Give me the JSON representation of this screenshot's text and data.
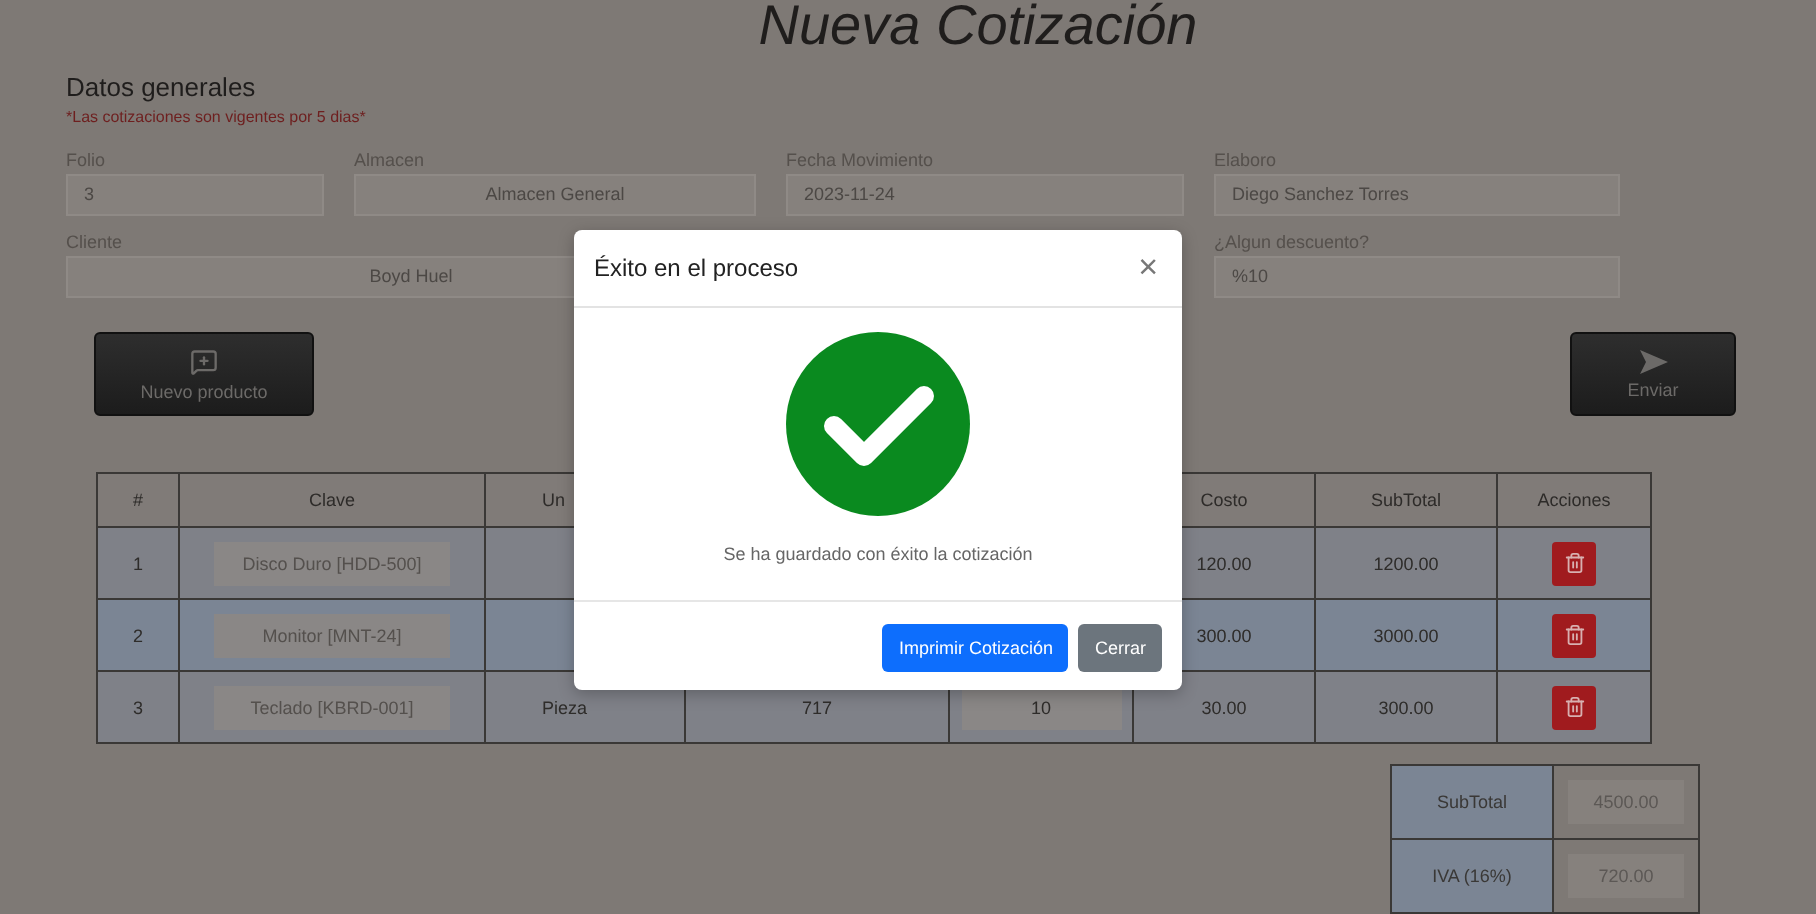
{
  "title": "Nueva Cotización",
  "section": {
    "heading": "Datos generales",
    "note": "*Las cotizaciones son vigentes por 5 dias*"
  },
  "fields": [
    {
      "label": "Folio",
      "value": "3",
      "kind": "text"
    },
    {
      "label": "Almacen",
      "value": "Almacen General",
      "kind": "select"
    },
    {
      "label": "Fecha Movimiento",
      "value": "2023-11-24",
      "kind": "text"
    },
    {
      "label": "Elaboro",
      "value": "Diego Sanchez Torres",
      "kind": "text"
    },
    {
      "label": "Cliente",
      "value": "Boyd Huel",
      "kind": "select",
      "wide": true
    },
    {
      "label": "¿Algun descuento?",
      "value": "%10",
      "kind": "text"
    }
  ],
  "actions": [
    {
      "label": "Nuevo producto",
      "kind": "add"
    },
    {
      "label": "Enviar",
      "kind": "send"
    }
  ],
  "table": {
    "columns": [
      "#",
      "Clave",
      "Un",
      null,
      null,
      "Costo",
      "SubTotal",
      "Acciones"
    ],
    "rows": [
      {
        "number": "1",
        "clave": "Disco Duro [HDD-500]",
        "costo": "120.00",
        "subtotal": "1200.00"
      },
      {
        "number": "2",
        "clave": "Monitor [MNT-24]",
        "costo": "300.00",
        "subtotal": "3000.00"
      },
      {
        "number": "3",
        "clave": "Teclado [KBRD-001]",
        "unidad": "Pieza",
        "column_4": "717",
        "column_5": "10",
        "costo": "30.00",
        "subtotal": "300.00"
      }
    ]
  },
  "totals": [
    {
      "label": "SubTotal",
      "value": "4500.00"
    },
    {
      "label": "IVA (16%)",
      "value": "720.00"
    }
  ],
  "modal": {
    "title": "Éxito en el proceso",
    "close": "×",
    "message": "Se ha guardado con éxito la cotización",
    "buttons": [
      {
        "label": "Imprimir Cotización",
        "kind": "primary"
      },
      {
        "label": "Cerrar",
        "kind": "secondary"
      }
    ]
  }
}
